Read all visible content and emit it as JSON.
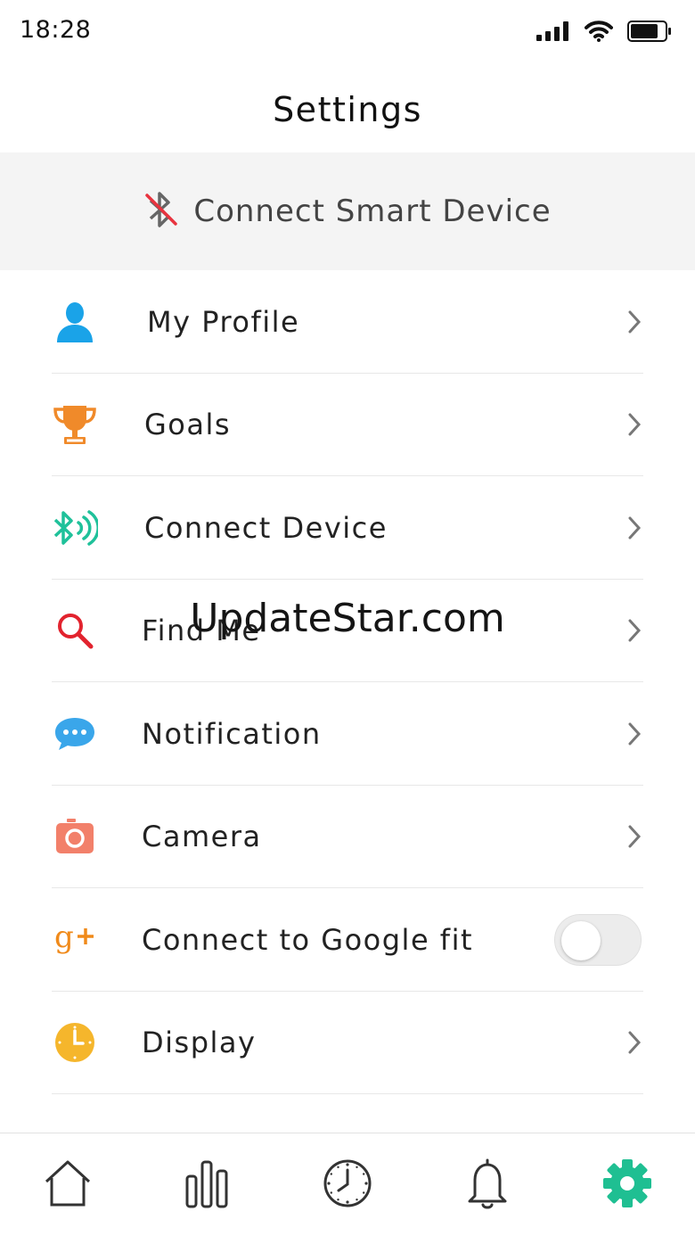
{
  "status_bar": {
    "time": "18:28",
    "icons": [
      "signal-icon",
      "wifi-icon",
      "battery-icon"
    ]
  },
  "header": {
    "title": "Settings"
  },
  "connect_banner": {
    "label": "Connect Smart Device",
    "icon": "bluetooth-disabled-icon",
    "icon_color": "#e8343f"
  },
  "settings": {
    "items": [
      {
        "label": "My Profile",
        "icon": "user-icon",
        "color": "#1aa3e8",
        "control": "chevron"
      },
      {
        "label": "Goals",
        "icon": "trophy-icon",
        "color": "#f08a2a",
        "control": "chevron"
      },
      {
        "label": "Connect Device",
        "icon": "bluetooth-icon",
        "color": "#1fc19a",
        "control": "chevron"
      },
      {
        "label": "Find Me",
        "icon": "search-icon",
        "color": "#e2232e",
        "control": "chevron"
      },
      {
        "label": "Notification",
        "icon": "chat-bubble-icon",
        "color": "#3aa6ea",
        "control": "chevron"
      },
      {
        "label": "Camera",
        "icon": "camera-icon",
        "color": "#f2806a",
        "control": "chevron"
      },
      {
        "label": "Connect to Google fit",
        "icon": "google-plus-icon",
        "color": "#f08a1a",
        "control": "toggle",
        "toggle_on": false
      },
      {
        "label": "Display",
        "icon": "clock-icon",
        "color": "#f5b62c",
        "control": "chevron"
      }
    ]
  },
  "watermark": "UpdateStar.com",
  "tab_bar": {
    "tabs": [
      {
        "name": "home",
        "icon": "home-icon",
        "active": false
      },
      {
        "name": "stats",
        "icon": "bar-chart-icon",
        "active": false
      },
      {
        "name": "history",
        "icon": "clock-icon",
        "active": false
      },
      {
        "name": "alerts",
        "icon": "bell-icon",
        "active": false
      },
      {
        "name": "settings",
        "icon": "gear-icon",
        "active": true
      }
    ],
    "active_color": "#1fbf92",
    "inactive_color": "#333333"
  }
}
